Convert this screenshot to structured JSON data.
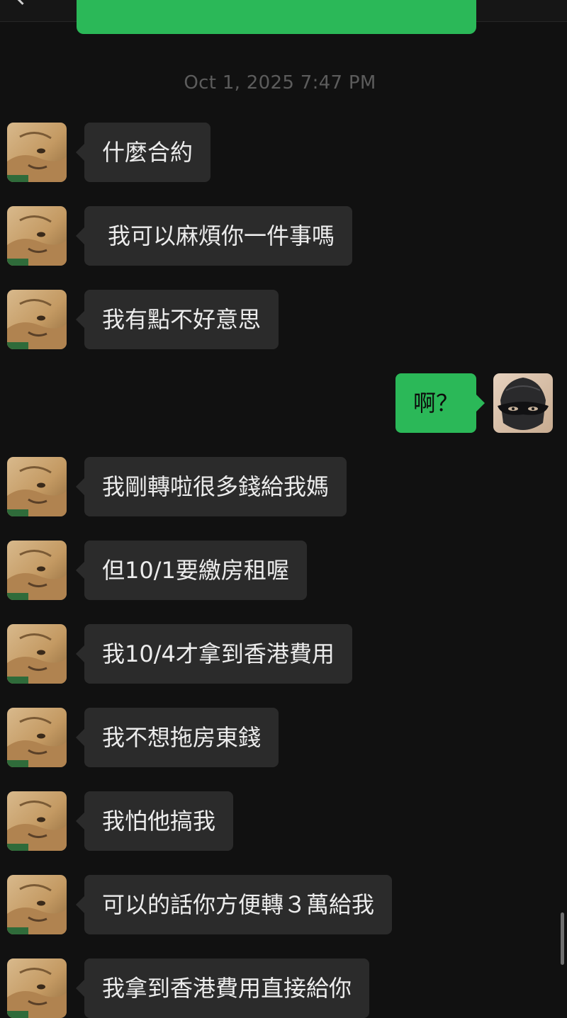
{
  "conversation": {
    "timestamp": "Oct 1, 2025 7:47 PM",
    "messages": [
      {
        "side": "left",
        "text": "什麼合約",
        "avatar": "lion-cub-avatar"
      },
      {
        "side": "left",
        "text": "我可以麻煩你一件事嗎",
        "avatar": "lion-cub-avatar"
      },
      {
        "side": "left",
        "text": "我有點不好意思",
        "avatar": "lion-cub-avatar"
      },
      {
        "side": "right",
        "text": "啊？",
        "avatar": "masked-figure-avatar"
      },
      {
        "side": "left",
        "text": "我剛轉啦很多錢給我媽",
        "avatar": "lion-cub-avatar"
      },
      {
        "side": "left",
        "text": "但10/1要繳房租喔",
        "avatar": "lion-cub-avatar"
      },
      {
        "side": "left",
        "text": "我10/4才拿到香港費用",
        "avatar": "lion-cub-avatar"
      },
      {
        "side": "left",
        "text": "我不想拖房東錢",
        "avatar": "lion-cub-avatar"
      },
      {
        "side": "left",
        "text": "我怕他搞我",
        "avatar": "lion-cub-avatar"
      },
      {
        "side": "left",
        "text": "可以的話你方便轉３萬給我",
        "avatar": "lion-cub-avatar"
      },
      {
        "side": "left",
        "text": "我拿到香港費用直接給你",
        "avatar": "lion-cub-avatar"
      }
    ]
  },
  "theme": {
    "background": "#111111",
    "incoming_bubble": "#2b2b2b",
    "outgoing_bubble": "#2bb858",
    "timestamp_color": "#5c5c5c"
  }
}
